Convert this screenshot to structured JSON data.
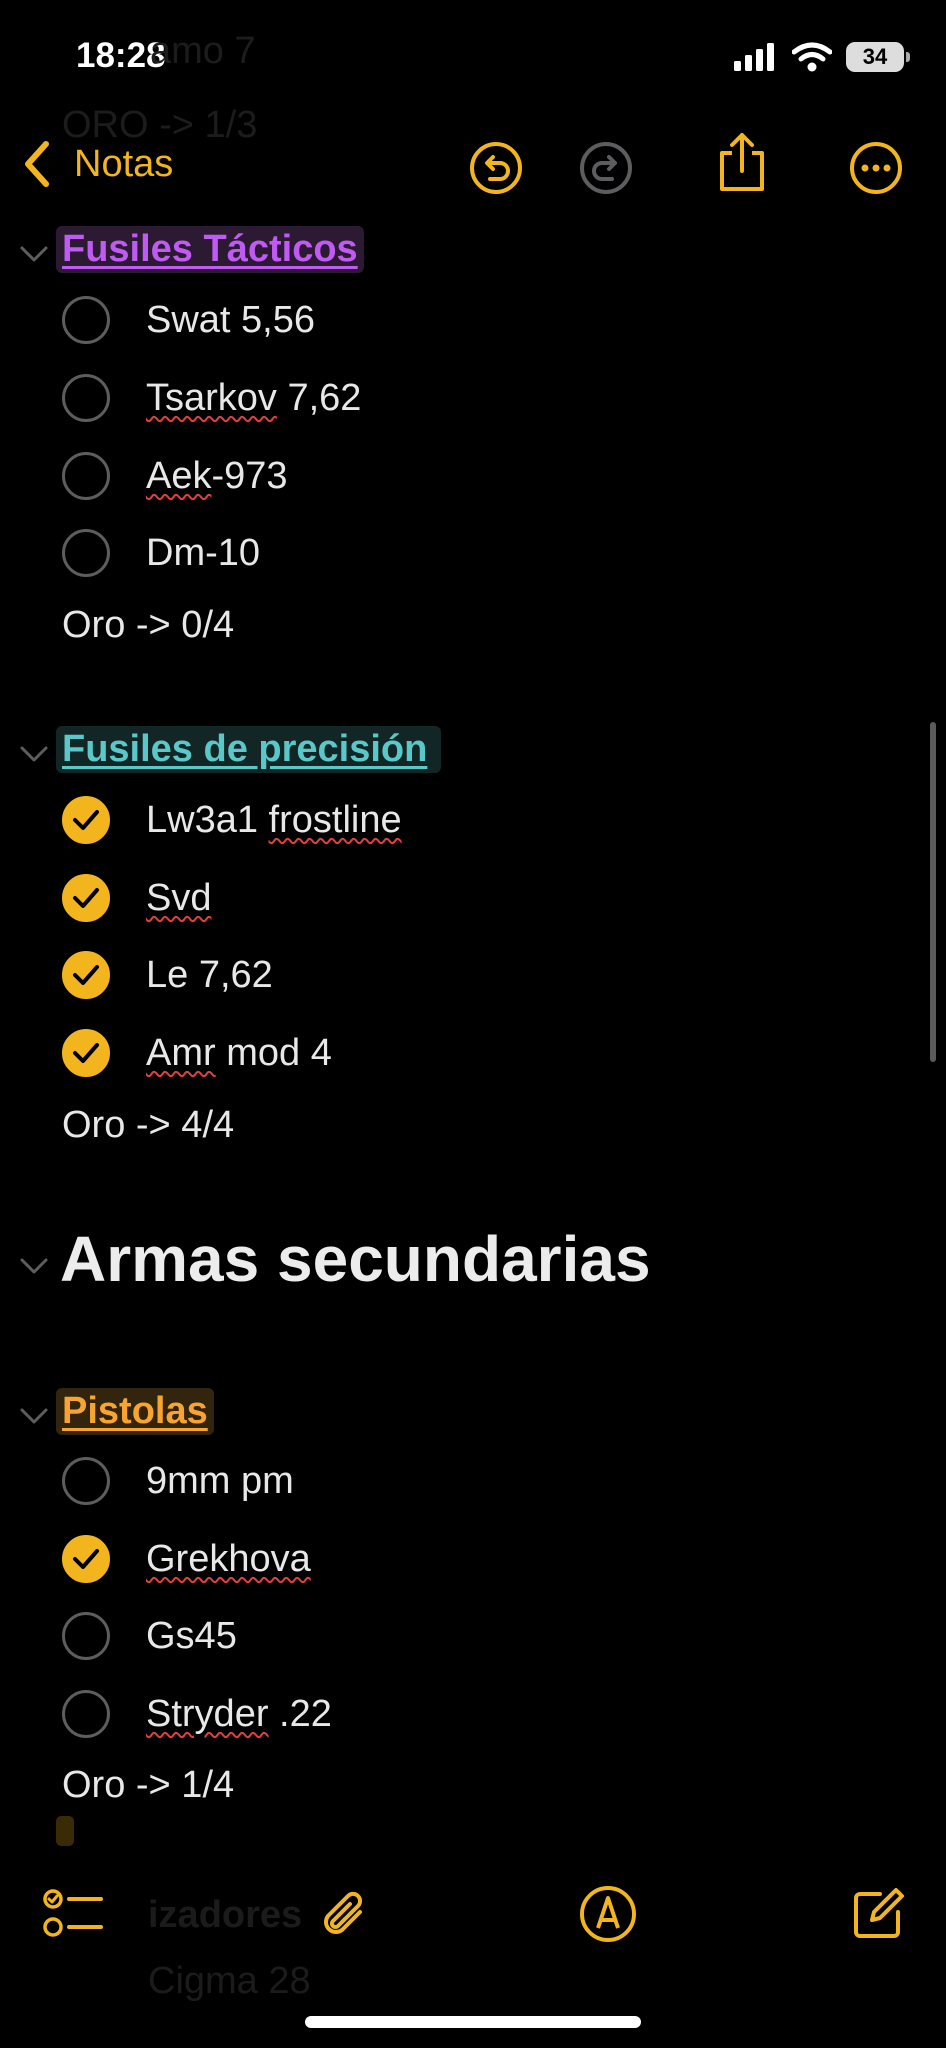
{
  "status_bar": {
    "time": "18:28",
    "battery": "34"
  },
  "ghost_text": {
    "line1": "amo 7",
    "line2": "ORO -> 1/3",
    "bottom": "Cigma 28",
    "bottom_header": "izadores"
  },
  "nav": {
    "back_label": "Notas",
    "undo_icon": "undo-icon",
    "redo_icon": "redo-icon",
    "share_icon": "share-icon",
    "more_icon": "more-icon"
  },
  "colors": {
    "accent": "#f2b51d",
    "purple": "#bf5af2",
    "teal": "#5ac8c8",
    "orange": "#f7a530"
  },
  "sections": [
    {
      "title": "Fusiles Tácticos",
      "items": [
        {
          "text": "Swat 5,56",
          "done": false
        },
        {
          "text_a": "Tsarkov",
          "text_b": " 7,62",
          "done": false
        },
        {
          "text_a": "Aek",
          "text_b": "-973",
          "done": false
        },
        {
          "text": "Dm-10",
          "done": false
        }
      ],
      "summary": "Oro -> 0/4"
    },
    {
      "title": "Fusiles de precisión",
      "items": [
        {
          "text_a": "Lw3a1 ",
          "text_b": "frostline",
          "done": true
        },
        {
          "text": "Svd",
          "done": true
        },
        {
          "text": "Le 7,62",
          "done": true
        },
        {
          "text_a": "Amr",
          "text_b": " mod 4",
          "done": true
        }
      ],
      "summary": "Oro -> 4/4"
    },
    {
      "title": "Armas secundarias"
    },
    {
      "title": "Pistolas",
      "items": [
        {
          "text": "9mm pm",
          "done": false
        },
        {
          "text": "Grekhova",
          "done": true
        },
        {
          "text": "Gs45",
          "done": false
        },
        {
          "text_a": "Stryder",
          "text_b": " .22",
          "done": false
        }
      ],
      "summary": "Oro -> 1/4"
    }
  ],
  "toolbar": {
    "checklist_icon": "checklist-icon",
    "attachment_icon": "paperclip-icon",
    "markup_icon": "markup-pen-icon",
    "compose_icon": "compose-icon"
  }
}
